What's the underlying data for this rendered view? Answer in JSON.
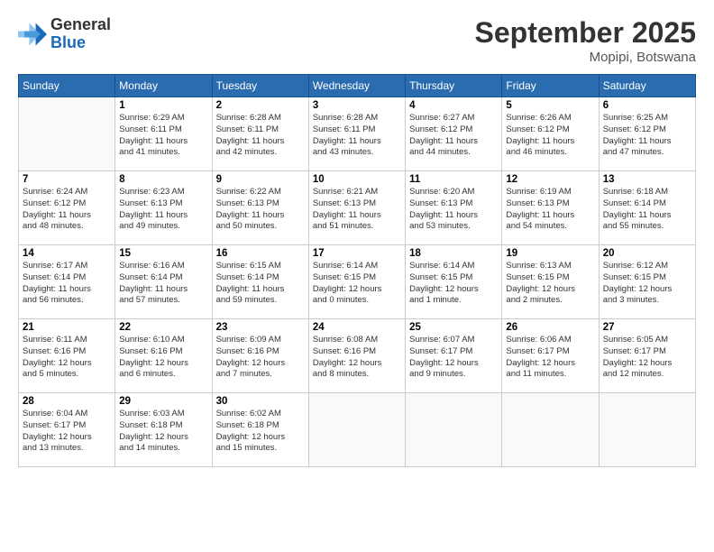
{
  "header": {
    "logo_general": "General",
    "logo_blue": "Blue",
    "month_title": "September 2025",
    "location": "Mopipi, Botswana"
  },
  "weekdays": [
    "Sunday",
    "Monday",
    "Tuesday",
    "Wednesday",
    "Thursday",
    "Friday",
    "Saturday"
  ],
  "weeks": [
    [
      {
        "day": "",
        "info": ""
      },
      {
        "day": "1",
        "info": "Sunrise: 6:29 AM\nSunset: 6:11 PM\nDaylight: 11 hours\nand 41 minutes."
      },
      {
        "day": "2",
        "info": "Sunrise: 6:28 AM\nSunset: 6:11 PM\nDaylight: 11 hours\nand 42 minutes."
      },
      {
        "day": "3",
        "info": "Sunrise: 6:28 AM\nSunset: 6:11 PM\nDaylight: 11 hours\nand 43 minutes."
      },
      {
        "day": "4",
        "info": "Sunrise: 6:27 AM\nSunset: 6:12 PM\nDaylight: 11 hours\nand 44 minutes."
      },
      {
        "day": "5",
        "info": "Sunrise: 6:26 AM\nSunset: 6:12 PM\nDaylight: 11 hours\nand 46 minutes."
      },
      {
        "day": "6",
        "info": "Sunrise: 6:25 AM\nSunset: 6:12 PM\nDaylight: 11 hours\nand 47 minutes."
      }
    ],
    [
      {
        "day": "7",
        "info": "Sunrise: 6:24 AM\nSunset: 6:12 PM\nDaylight: 11 hours\nand 48 minutes."
      },
      {
        "day": "8",
        "info": "Sunrise: 6:23 AM\nSunset: 6:13 PM\nDaylight: 11 hours\nand 49 minutes."
      },
      {
        "day": "9",
        "info": "Sunrise: 6:22 AM\nSunset: 6:13 PM\nDaylight: 11 hours\nand 50 minutes."
      },
      {
        "day": "10",
        "info": "Sunrise: 6:21 AM\nSunset: 6:13 PM\nDaylight: 11 hours\nand 51 minutes."
      },
      {
        "day": "11",
        "info": "Sunrise: 6:20 AM\nSunset: 6:13 PM\nDaylight: 11 hours\nand 53 minutes."
      },
      {
        "day": "12",
        "info": "Sunrise: 6:19 AM\nSunset: 6:13 PM\nDaylight: 11 hours\nand 54 minutes."
      },
      {
        "day": "13",
        "info": "Sunrise: 6:18 AM\nSunset: 6:14 PM\nDaylight: 11 hours\nand 55 minutes."
      }
    ],
    [
      {
        "day": "14",
        "info": "Sunrise: 6:17 AM\nSunset: 6:14 PM\nDaylight: 11 hours\nand 56 minutes."
      },
      {
        "day": "15",
        "info": "Sunrise: 6:16 AM\nSunset: 6:14 PM\nDaylight: 11 hours\nand 57 minutes."
      },
      {
        "day": "16",
        "info": "Sunrise: 6:15 AM\nSunset: 6:14 PM\nDaylight: 11 hours\nand 59 minutes."
      },
      {
        "day": "17",
        "info": "Sunrise: 6:14 AM\nSunset: 6:15 PM\nDaylight: 12 hours\nand 0 minutes."
      },
      {
        "day": "18",
        "info": "Sunrise: 6:14 AM\nSunset: 6:15 PM\nDaylight: 12 hours\nand 1 minute."
      },
      {
        "day": "19",
        "info": "Sunrise: 6:13 AM\nSunset: 6:15 PM\nDaylight: 12 hours\nand 2 minutes."
      },
      {
        "day": "20",
        "info": "Sunrise: 6:12 AM\nSunset: 6:15 PM\nDaylight: 12 hours\nand 3 minutes."
      }
    ],
    [
      {
        "day": "21",
        "info": "Sunrise: 6:11 AM\nSunset: 6:16 PM\nDaylight: 12 hours\nand 5 minutes."
      },
      {
        "day": "22",
        "info": "Sunrise: 6:10 AM\nSunset: 6:16 PM\nDaylight: 12 hours\nand 6 minutes."
      },
      {
        "day": "23",
        "info": "Sunrise: 6:09 AM\nSunset: 6:16 PM\nDaylight: 12 hours\nand 7 minutes."
      },
      {
        "day": "24",
        "info": "Sunrise: 6:08 AM\nSunset: 6:16 PM\nDaylight: 12 hours\nand 8 minutes."
      },
      {
        "day": "25",
        "info": "Sunrise: 6:07 AM\nSunset: 6:17 PM\nDaylight: 12 hours\nand 9 minutes."
      },
      {
        "day": "26",
        "info": "Sunrise: 6:06 AM\nSunset: 6:17 PM\nDaylight: 12 hours\nand 11 minutes."
      },
      {
        "day": "27",
        "info": "Sunrise: 6:05 AM\nSunset: 6:17 PM\nDaylight: 12 hours\nand 12 minutes."
      }
    ],
    [
      {
        "day": "28",
        "info": "Sunrise: 6:04 AM\nSunset: 6:17 PM\nDaylight: 12 hours\nand 13 minutes."
      },
      {
        "day": "29",
        "info": "Sunrise: 6:03 AM\nSunset: 6:18 PM\nDaylight: 12 hours\nand 14 minutes."
      },
      {
        "day": "30",
        "info": "Sunrise: 6:02 AM\nSunset: 6:18 PM\nDaylight: 12 hours\nand 15 minutes."
      },
      {
        "day": "",
        "info": ""
      },
      {
        "day": "",
        "info": ""
      },
      {
        "day": "",
        "info": ""
      },
      {
        "day": "",
        "info": ""
      }
    ]
  ]
}
